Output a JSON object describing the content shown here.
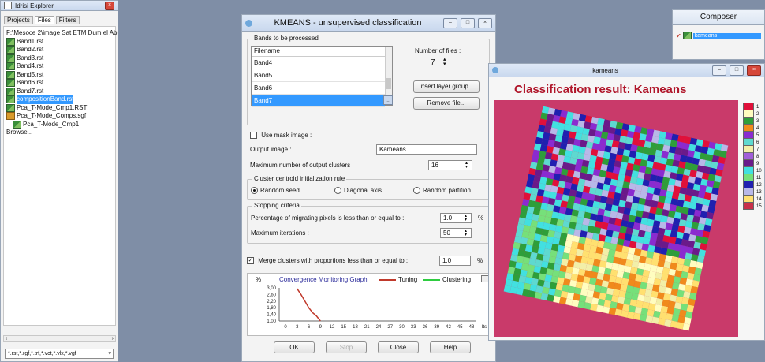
{
  "explorer": {
    "title": "Idrisi Explorer",
    "tabs": [
      "Projects",
      "Files",
      "Filters"
    ],
    "path": "F:\\Mesoce 2\\image Sat ETM Dum el Ab",
    "files": [
      {
        "name": "Band1.rst",
        "type": "raster",
        "indent": 0,
        "selected": false
      },
      {
        "name": "Band2.rst",
        "type": "raster",
        "indent": 0,
        "selected": false
      },
      {
        "name": "Band3.rst",
        "type": "raster",
        "indent": 0,
        "selected": false
      },
      {
        "name": "Band4.rst",
        "type": "raster",
        "indent": 0,
        "selected": false
      },
      {
        "name": "Band5.rst",
        "type": "raster",
        "indent": 0,
        "selected": false
      },
      {
        "name": "Band6.rst",
        "type": "raster",
        "indent": 0,
        "selected": false
      },
      {
        "name": "Band7.rst",
        "type": "raster",
        "indent": 0,
        "selected": false
      },
      {
        "name": "compositionBand.rst",
        "type": "raster",
        "indent": 0,
        "selected": true
      },
      {
        "name": "Pca_T-Mode_Cmp1.RST",
        "type": "raster",
        "indent": 0,
        "selected": false
      },
      {
        "name": "Pca_T-Mode_Comps.sgf",
        "type": "vector",
        "indent": 0,
        "selected": false
      },
      {
        "name": "Pca_T-Mode_Cmp1",
        "type": "raster",
        "indent": 1,
        "selected": false
      }
    ],
    "browser_label": "Browse...",
    "filter_value": "*.rst,*.rgf,*.trf,*.vct,*.vlx,*.vgf"
  },
  "kmeans": {
    "title": "KMEANS - unsupervised classification",
    "bands_group": "Bands to be processed",
    "bands_header": "Filename",
    "bands": [
      "Band4",
      "Band5",
      "Band6",
      "Band7"
    ],
    "selected_band": "Band7",
    "num_files_label": "Number of files :",
    "num_files": "7",
    "insert_btn": "Insert layer group...",
    "remove_btn": "Remove file...",
    "mask_label": "Use mask image :",
    "output_label": "Output image :",
    "output_value": "Kameans",
    "max_clusters_label": "Maximum number of output clusters :",
    "max_clusters": "16",
    "centroid_group": "Cluster centroid initialization rule",
    "centroid_options": [
      "Random seed",
      "Diagonal axis",
      "Random partition"
    ],
    "stopping_group": "Stopping criteria",
    "pct_label": "Percentage of migrating pixels is less than or equal to :",
    "pct_value": "1.0",
    "max_iter_label": "Maximum iterations :",
    "max_iter": "50",
    "merge_label": "Merge clusters with proportions less than or equal to :",
    "merge_value": "1.0",
    "pct_symbol": "%",
    "graph_title": "Convergence Monitoring Graph",
    "graph_pct": "%",
    "legend_tuning": "Tuning",
    "legend_clustering": "Clustering",
    "ok": "OK",
    "stop": "Stop",
    "close": "Close",
    "help": "Help"
  },
  "chart_data": {
    "type": "line",
    "title": "Convergence Monitoring Graph",
    "ylabel": "%",
    "xlabel": "Its",
    "y_ticks": [
      "3,00",
      "2,60",
      "2,20",
      "1,80",
      "1,40",
      "1,00"
    ],
    "x_ticks": [
      "0",
      "3",
      "6",
      "9",
      "12",
      "15",
      "18",
      "21",
      "24",
      "27",
      "30",
      "33",
      "36",
      "39",
      "42",
      "45",
      "48"
    ],
    "ylim": [
      1.0,
      3.0
    ],
    "xlim": [
      0,
      48
    ],
    "series": [
      {
        "name": "Tuning",
        "color": "#c0392b",
        "x": [
          3,
          4,
          5,
          6,
          7,
          8,
          9
        ],
        "y": [
          2.95,
          2.6,
          2.2,
          1.8,
          1.5,
          1.3,
          1.0
        ]
      },
      {
        "name": "Clustering",
        "color": "#2ecc40",
        "x": [],
        "y": []
      }
    ]
  },
  "composer": {
    "title": "Composer",
    "layer": "kameans"
  },
  "result": {
    "window_title": "kameans",
    "heading": "Classification result: Kameans",
    "legend": [
      {
        "label": "1",
        "color": "#e0103a"
      },
      {
        "label": "2",
        "color": "#fffdc0"
      },
      {
        "label": "3",
        "color": "#2e9e3a"
      },
      {
        "label": "4",
        "color": "#f08a1c"
      },
      {
        "label": "5",
        "color": "#8a2bd0"
      },
      {
        "label": "6",
        "color": "#5ed9d0"
      },
      {
        "label": "7",
        "color": "#f2efa8"
      },
      {
        "label": "8",
        "color": "#a05ed8"
      },
      {
        "label": "9",
        "color": "#6a1a8a"
      },
      {
        "label": "10",
        "color": "#42e0e0"
      },
      {
        "label": "11",
        "color": "#76e07a"
      },
      {
        "label": "12",
        "color": "#2020b0"
      },
      {
        "label": "13",
        "color": "#b8b8e8"
      },
      {
        "label": "14",
        "color": "#ffe070"
      },
      {
        "label": "15",
        "color": "#c8304a"
      }
    ]
  }
}
